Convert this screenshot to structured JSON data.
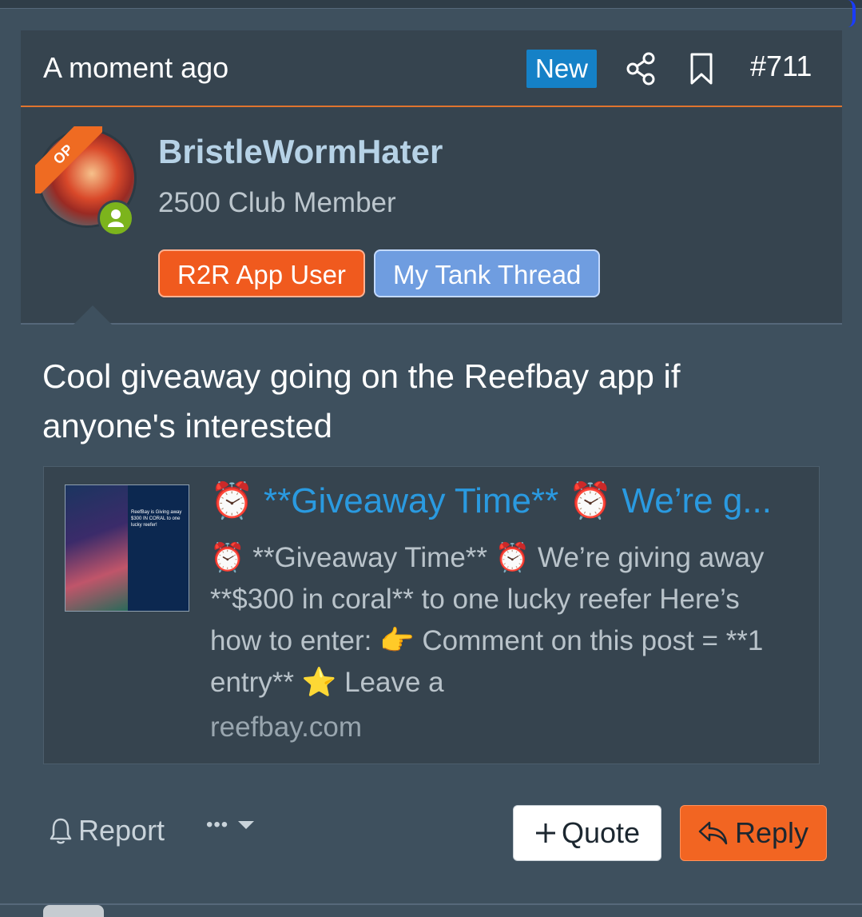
{
  "post": {
    "time": "A moment ago",
    "new_badge": "New",
    "number": "#711",
    "op_badge": "OP"
  },
  "user": {
    "name": "BristleWormHater",
    "title": "2500 Club Member",
    "banners": [
      "R2R App User",
      "My Tank Thread"
    ]
  },
  "message": "Cool giveaway going on the Reefbay app if anyone's interested",
  "embed": {
    "title": "⏰ **Giveaway Time** ⏰ We’re g...",
    "description": "⏰ **Giveaway Time** ⏰ We’re giving away **$300 in coral** to one lucky reefer Here’s how to enter: 👉 Comment on this post = **1 entry** ⭐ Leave a",
    "domain": "reefbay.com",
    "thumbnail_text": "ReefBay is Giving away $300 IN CORAL to one lucky reefer!"
  },
  "actions": {
    "report": "Report",
    "more": "•••",
    "quote": "Quote",
    "reply": "Reply"
  }
}
